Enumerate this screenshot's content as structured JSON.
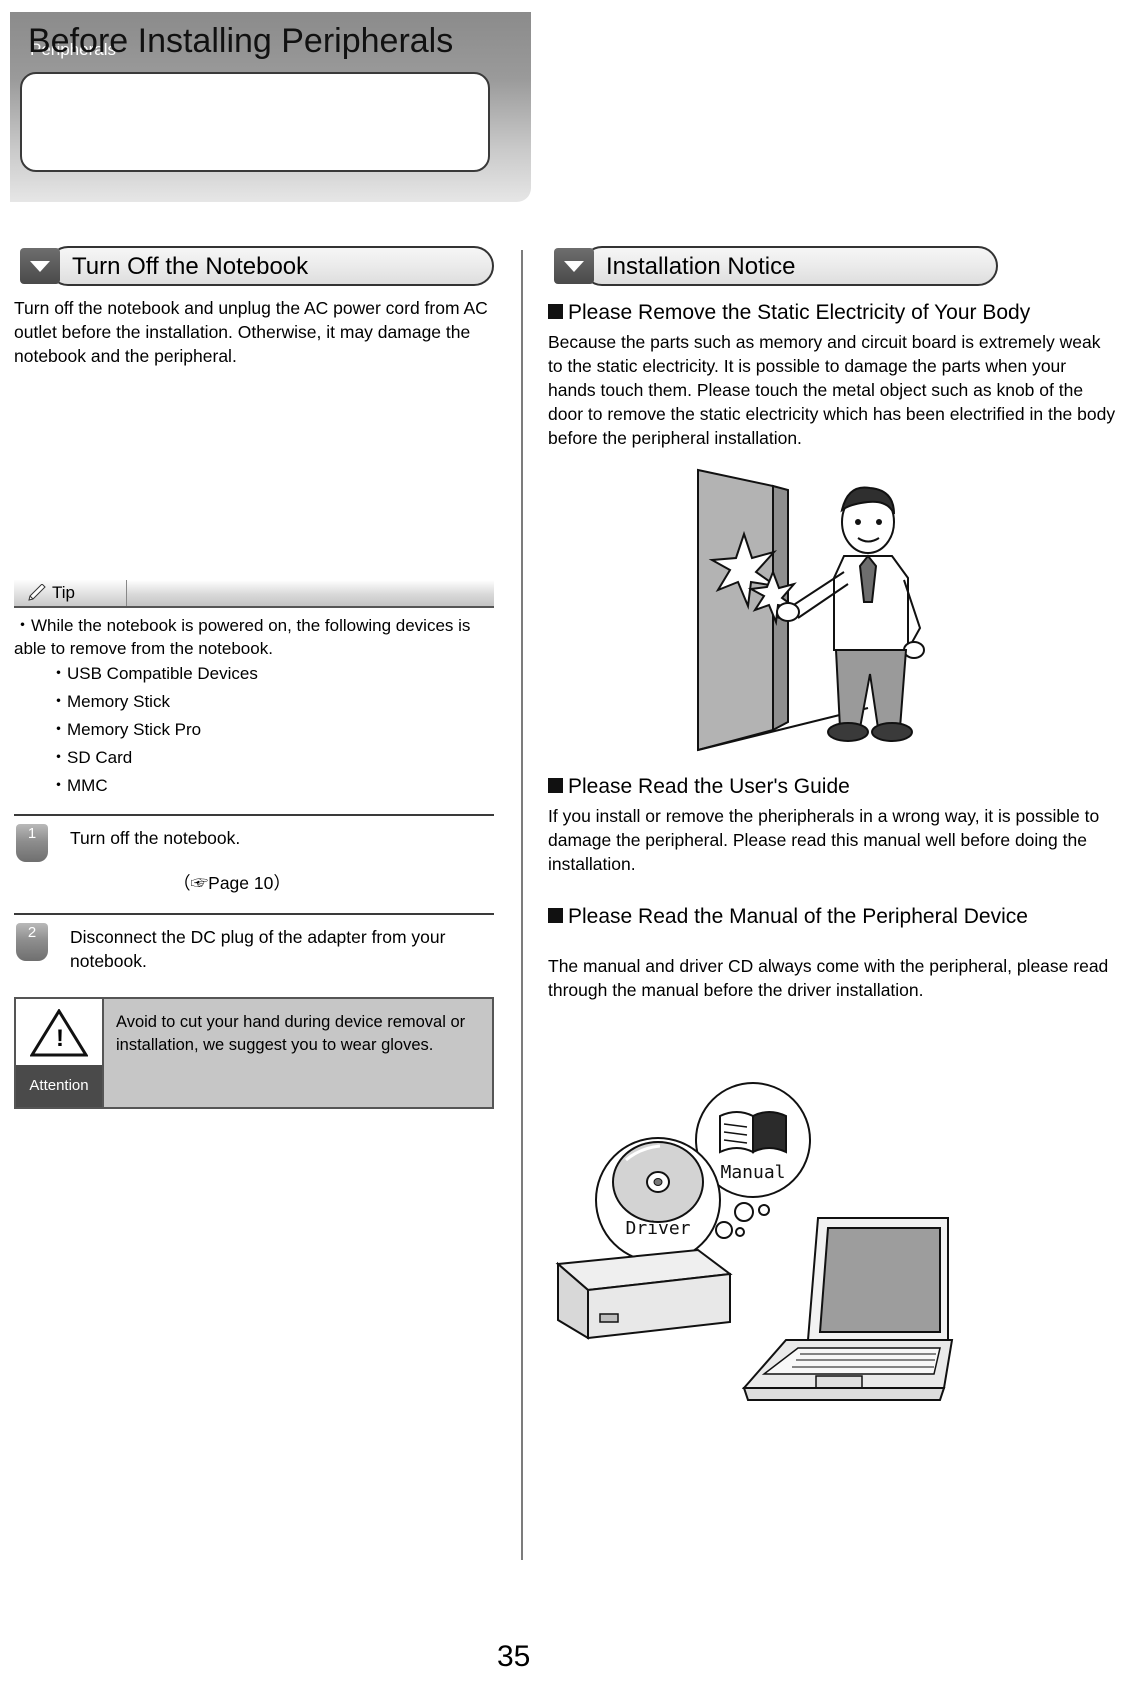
{
  "header": {
    "chapter": "Peripherals",
    "title": "Before Installing Peripherals"
  },
  "left": {
    "section_title": "Turn Off the Notebook",
    "intro": "Turn off the notebook and unplug the AC power cord from AC outlet before the installation. Otherwise, it may damage the notebook and the peripheral.",
    "tip": {
      "label": "Tip",
      "icon": "pencil-icon",
      "line": "・While the notebook is powered on, the following devices is able to remove from the notebook.",
      "items": [
        "・USB Compatible Devices",
        "・Memory Stick",
        "・Memory Stick Pro",
        "・SD Card",
        "・MMC"
      ]
    },
    "steps": [
      {
        "num": "1",
        "text": "Turn off the notebook.",
        "ref": "（☞Page 10）"
      },
      {
        "num": "2",
        "text": "Disconnect the DC plug of the adapter from your notebook.",
        "ref": ""
      }
    ],
    "attention": {
      "word": "Attention",
      "icon": "warning-triangle-icon",
      "text": "Avoid to cut your hand during device removal or installation, we suggest you to wear gloves."
    }
  },
  "right": {
    "section_title": "Installation Notice",
    "blocks": [
      {
        "heading": "Please Remove the Static Electricity of Your Body",
        "text": "Because the parts such as memory and circuit board is extremely weak to the static electricity. It is possible to damage the parts when your hands touch them. Please touch the metal object such as knob of the door to remove the static electricity which has been electrified in the body before the peripheral installation."
      },
      {
        "heading": "Please Read the User's Guide",
        "text": "If you install or remove the pheripherals in a wrong way, it is possible to damage the peripheral. Please read this manual well before doing the installation."
      },
      {
        "heading": "Please Read the Manual of the Peripheral Device",
        "text": "The manual and driver CD always come with the peripheral, please read through the manual before the driver installation."
      }
    ],
    "figure_labels": {
      "driver": "Driver",
      "manual": "Manual"
    }
  },
  "page_number": "35"
}
